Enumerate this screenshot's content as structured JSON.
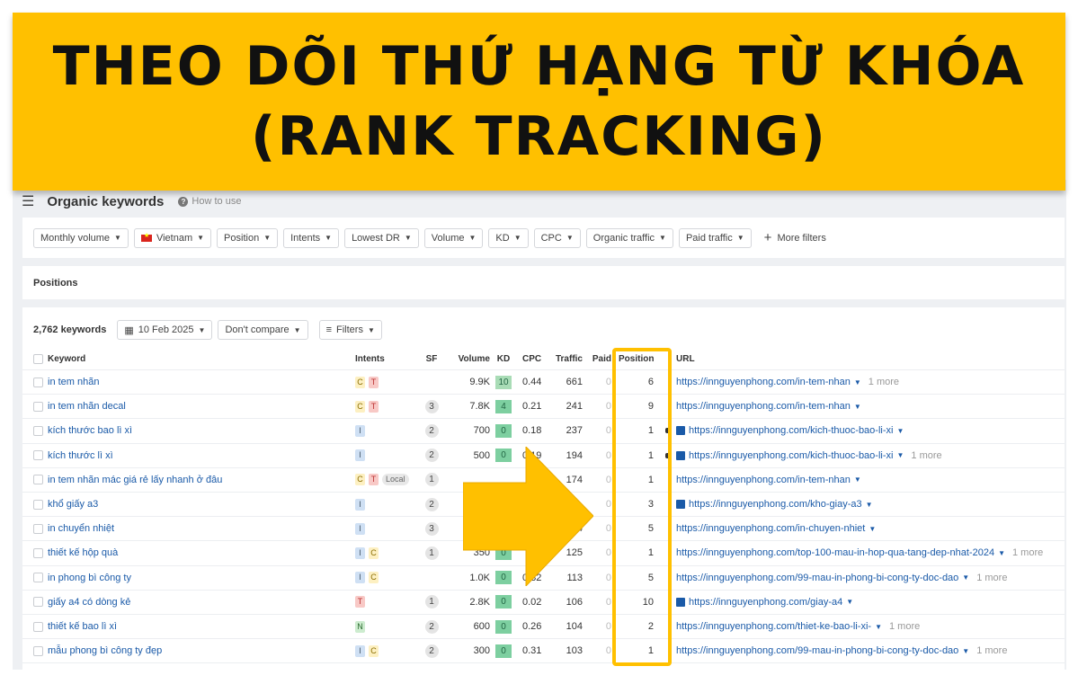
{
  "banner": {
    "line1": "THEO DÕI THỨ HẠNG TỪ KHÓA",
    "line2": "(RANK TRACKING)"
  },
  "header": {
    "menu_icon": "hamburger-icon",
    "title": "Organic keywords",
    "help": "How to use"
  },
  "filters": [
    "Monthly volume",
    "Vietnam",
    "Position",
    "Intents",
    "Lowest DR",
    "Volume",
    "KD",
    "CPC",
    "Organic traffic",
    "Paid traffic"
  ],
  "more_filters": "More filters",
  "section": "Positions",
  "toolbar": {
    "count": "2,762 keywords",
    "date": "10 Feb 2025",
    "compare": "Don't compare",
    "filters": "Filters"
  },
  "columns": {
    "keyword": "Keyword",
    "intents": "Intents",
    "sf": "SF",
    "volume": "Volume",
    "kd": "KD",
    "cpc": "CPC",
    "traffic": "Traffic",
    "paid": "Paid",
    "position": "Position",
    "url": "URL"
  },
  "rows": [
    {
      "keyword": "in tem nhãn",
      "intents": [
        "C",
        "T"
      ],
      "sf": "",
      "volume": "9.9K",
      "kd": "10",
      "cpc": "0.44",
      "traffic": "661",
      "paid": "0",
      "position": "6",
      "img": false,
      "url": "https://innguyenphong.com/in-tem-nhan",
      "more": "1 more"
    },
    {
      "keyword": "in tem nhãn decal",
      "intents": [
        "C",
        "T"
      ],
      "sf": "3",
      "volume": "7.8K",
      "kd": "4",
      "cpc": "0.21",
      "traffic": "241",
      "paid": "0",
      "position": "9",
      "img": false,
      "url": "https://innguyenphong.com/in-tem-nhan",
      "more": ""
    },
    {
      "keyword": "kích thước bao lì xì",
      "intents": [
        "I"
      ],
      "sf": "2",
      "volume": "700",
      "kd": "0",
      "cpc": "0.18",
      "traffic": "237",
      "paid": "0",
      "position": "1",
      "img": true,
      "url": "https://innguyenphong.com/kich-thuoc-bao-li-xi",
      "more": ""
    },
    {
      "keyword": "kích thước lì xì",
      "intents": [
        "I"
      ],
      "sf": "2",
      "volume": "500",
      "kd": "0",
      "cpc": "0.19",
      "traffic": "194",
      "paid": "0",
      "position": "1",
      "img": true,
      "url": "https://innguyenphong.com/kich-thuoc-bao-li-xi",
      "more": "1 more"
    },
    {
      "keyword": "in tem nhãn mác giá rẻ lấy nhanh ở đâu",
      "intents": [
        "C",
        "T",
        "Local"
      ],
      "sf": "1",
      "volume": "",
      "kd": "",
      "cpc": "",
      "traffic": "174",
      "paid": "0",
      "position": "1",
      "img": false,
      "url": "https://innguyenphong.com/in-tem-nhan",
      "more": ""
    },
    {
      "keyword": "khổ giấy a3",
      "intents": [
        "I"
      ],
      "sf": "2",
      "volume": "",
      "kd": "",
      "cpc": "",
      "traffic": "",
      "paid": "0",
      "position": "3",
      "img": true,
      "url": "https://innguyenphong.com/kho-giay-a3",
      "more": ""
    },
    {
      "keyword": "in chuyển nhiệt",
      "intents": [
        "I"
      ],
      "sf": "3",
      "volume": "",
      "kd": "",
      "cpc": "",
      "traffic": "144",
      "paid": "0",
      "position": "5",
      "img": false,
      "url": "https://innguyenphong.com/in-chuyen-nhiet",
      "more": ""
    },
    {
      "keyword": "thiết kế hộp quà",
      "intents": [
        "I",
        "C"
      ],
      "sf": "1",
      "volume": "350",
      "kd": "0",
      "cpc": "",
      "traffic": "125",
      "paid": "0",
      "position": "1",
      "img": false,
      "url": "https://innguyenphong.com/top-100-mau-in-hop-qua-tang-dep-nhat-2024",
      "more": "1 more"
    },
    {
      "keyword": "in phong bì công ty",
      "intents": [
        "I",
        "C"
      ],
      "sf": "",
      "volume": "1.0K",
      "kd": "0",
      "cpc": "0.32",
      "traffic": "113",
      "paid": "0",
      "position": "5",
      "img": false,
      "url": "https://innguyenphong.com/99-mau-in-phong-bi-cong-ty-doc-dao",
      "more": "1 more"
    },
    {
      "keyword": "giấy a4 có dòng kẻ",
      "intents": [
        "T"
      ],
      "sf": "1",
      "volume": "2.8K",
      "kd": "0",
      "cpc": "0.02",
      "traffic": "106",
      "paid": "0",
      "position": "10",
      "img": true,
      "url": "https://innguyenphong.com/giay-a4",
      "more": ""
    },
    {
      "keyword": "thiết kế bao lì xì",
      "intents": [
        "N"
      ],
      "sf": "2",
      "volume": "600",
      "kd": "0",
      "cpc": "0.26",
      "traffic": "104",
      "paid": "0",
      "position": "2",
      "img": false,
      "url": "https://innguyenphong.com/thiet-ke-bao-li-xi-",
      "more": "1 more"
    },
    {
      "keyword": "mẫu phong bì công ty đẹp",
      "intents": [
        "I",
        "C"
      ],
      "sf": "2",
      "volume": "300",
      "kd": "0",
      "cpc": "0.31",
      "traffic": "103",
      "paid": "0",
      "position": "1",
      "img": false,
      "url": "https://innguyenphong.com/99-mau-in-phong-bi-cong-ty-doc-dao",
      "more": "1 more"
    }
  ],
  "colors": {
    "banner": "#FFC000",
    "link": "#1a5aa8",
    "kd_easy": "#7dcfa0"
  }
}
